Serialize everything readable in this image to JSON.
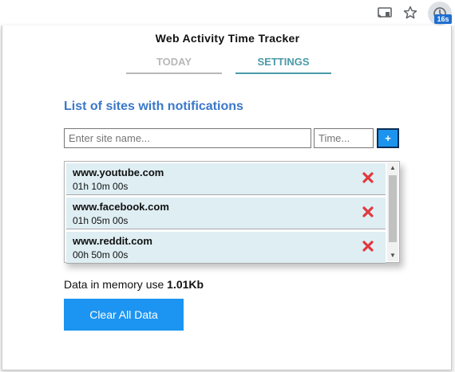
{
  "browser": {
    "extension_badge": "16s"
  },
  "popup": {
    "title": "Web Activity Time Tracker",
    "tabs": [
      {
        "label": "TODAY",
        "active": false
      },
      {
        "label": "SETTINGS",
        "active": true
      }
    ],
    "section_title": "List of sites with notifications",
    "site_input": {
      "placeholder": "Enter site name...",
      "value": ""
    },
    "time_input": {
      "placeholder": "Time...",
      "value": ""
    },
    "add_label": "+",
    "sites": [
      {
        "name": "www.youtube.com",
        "time": "01h 10m 00s"
      },
      {
        "name": "www.facebook.com",
        "time": "01h 05m 00s"
      },
      {
        "name": "www.reddit.com",
        "time": "00h 50m 00s"
      }
    ],
    "memory_label": "Data in memory use",
    "memory_value": "1.01Kb",
    "clear_label": "Clear All Data"
  },
  "colors": {
    "accent": "#4a9aa8",
    "title_blue": "#3a78c9",
    "button_blue": "#1c94f1",
    "delete_red": "#e0393e",
    "list_bg": "#deeef3"
  }
}
